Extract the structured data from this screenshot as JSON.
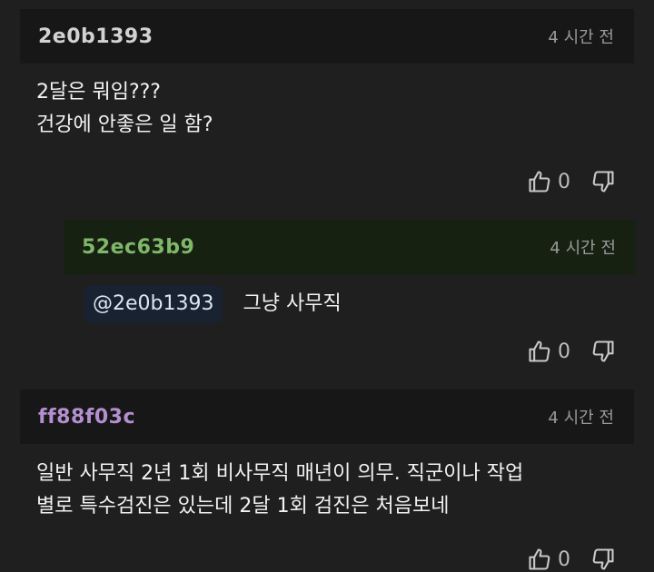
{
  "comments": [
    {
      "author": "2e0b1393",
      "author_color": "#d2d2d2",
      "time": "4 시간 전",
      "lines": [
        "2달은 뭐임???",
        "건강에 안좋은 일 함?"
      ],
      "likes": "0"
    },
    {
      "author": "52ec63b9",
      "author_color": "#7fb86a",
      "time": "4 시간 전",
      "mention": "@2e0b1393",
      "text": "그냥 사무직",
      "likes": "0"
    },
    {
      "author": "ff88f03c",
      "author_color": "#b48fd0",
      "time": "4 시간 전",
      "lines": [
        "일반 사무직 2년 1회 비사무직 매년이 의무. 직군이나 작업",
        "별로 특수검진은 있는데 2달 1회 검진은 처음보네"
      ],
      "likes": "0"
    }
  ],
  "icons": {
    "like": "thumb-up-icon",
    "dislike": "thumb-down-icon"
  }
}
